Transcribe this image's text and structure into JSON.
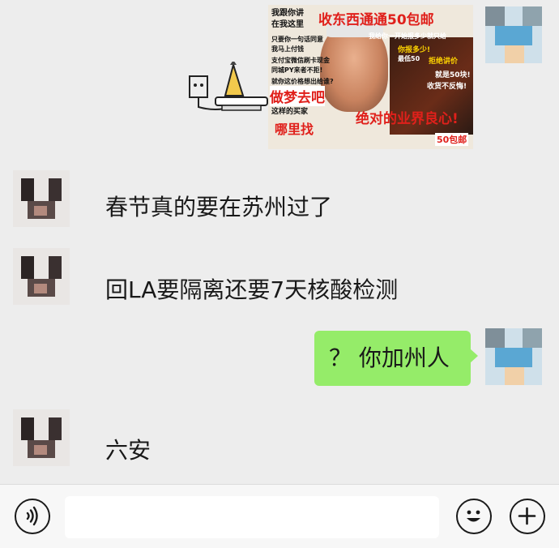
{
  "messages": [
    {
      "sender": "me",
      "type": "image",
      "meme": {
        "lines_left": [
          "我跟你讲",
          "在我这里",
          "只要你一句话同意",
          "我马上付钱",
          "支付宝微信刷卡现金",
          "同城PY来者不拒!",
          "就你这价格想出给谁?"
        ],
        "title": "收东西通通50包邮",
        "banner_left": "做梦去吧",
        "banner_left2": "这样的买家",
        "banner_left3": "哪里找",
        "banner_right": "绝对的业界良心!",
        "tag_right": "50包邮",
        "lines_right": [
          "我给你一开始报多少就只给",
          "你报多少!",
          "最低50",
          "拒绝讲价",
          "就是50块!",
          "收货不反悔!"
        ]
      }
    },
    {
      "sender": "other",
      "type": "text",
      "text": "春节真的要在苏州过了"
    },
    {
      "sender": "other",
      "type": "text",
      "text": "回LA要隔离还要7天核酸检测"
    },
    {
      "sender": "me",
      "type": "text",
      "text": "？ 你加州人"
    },
    {
      "sender": "other",
      "type": "text",
      "text": "六安"
    }
  ],
  "bottom_bar": {
    "voice_icon": "voice-icon",
    "emoji_icon": "emoji-icon",
    "plus_icon": "plus-icon",
    "input_value": ""
  },
  "colors": {
    "background": "#ededed",
    "my_bubble": "#95ec69",
    "other_bubble": "#ffffff"
  }
}
